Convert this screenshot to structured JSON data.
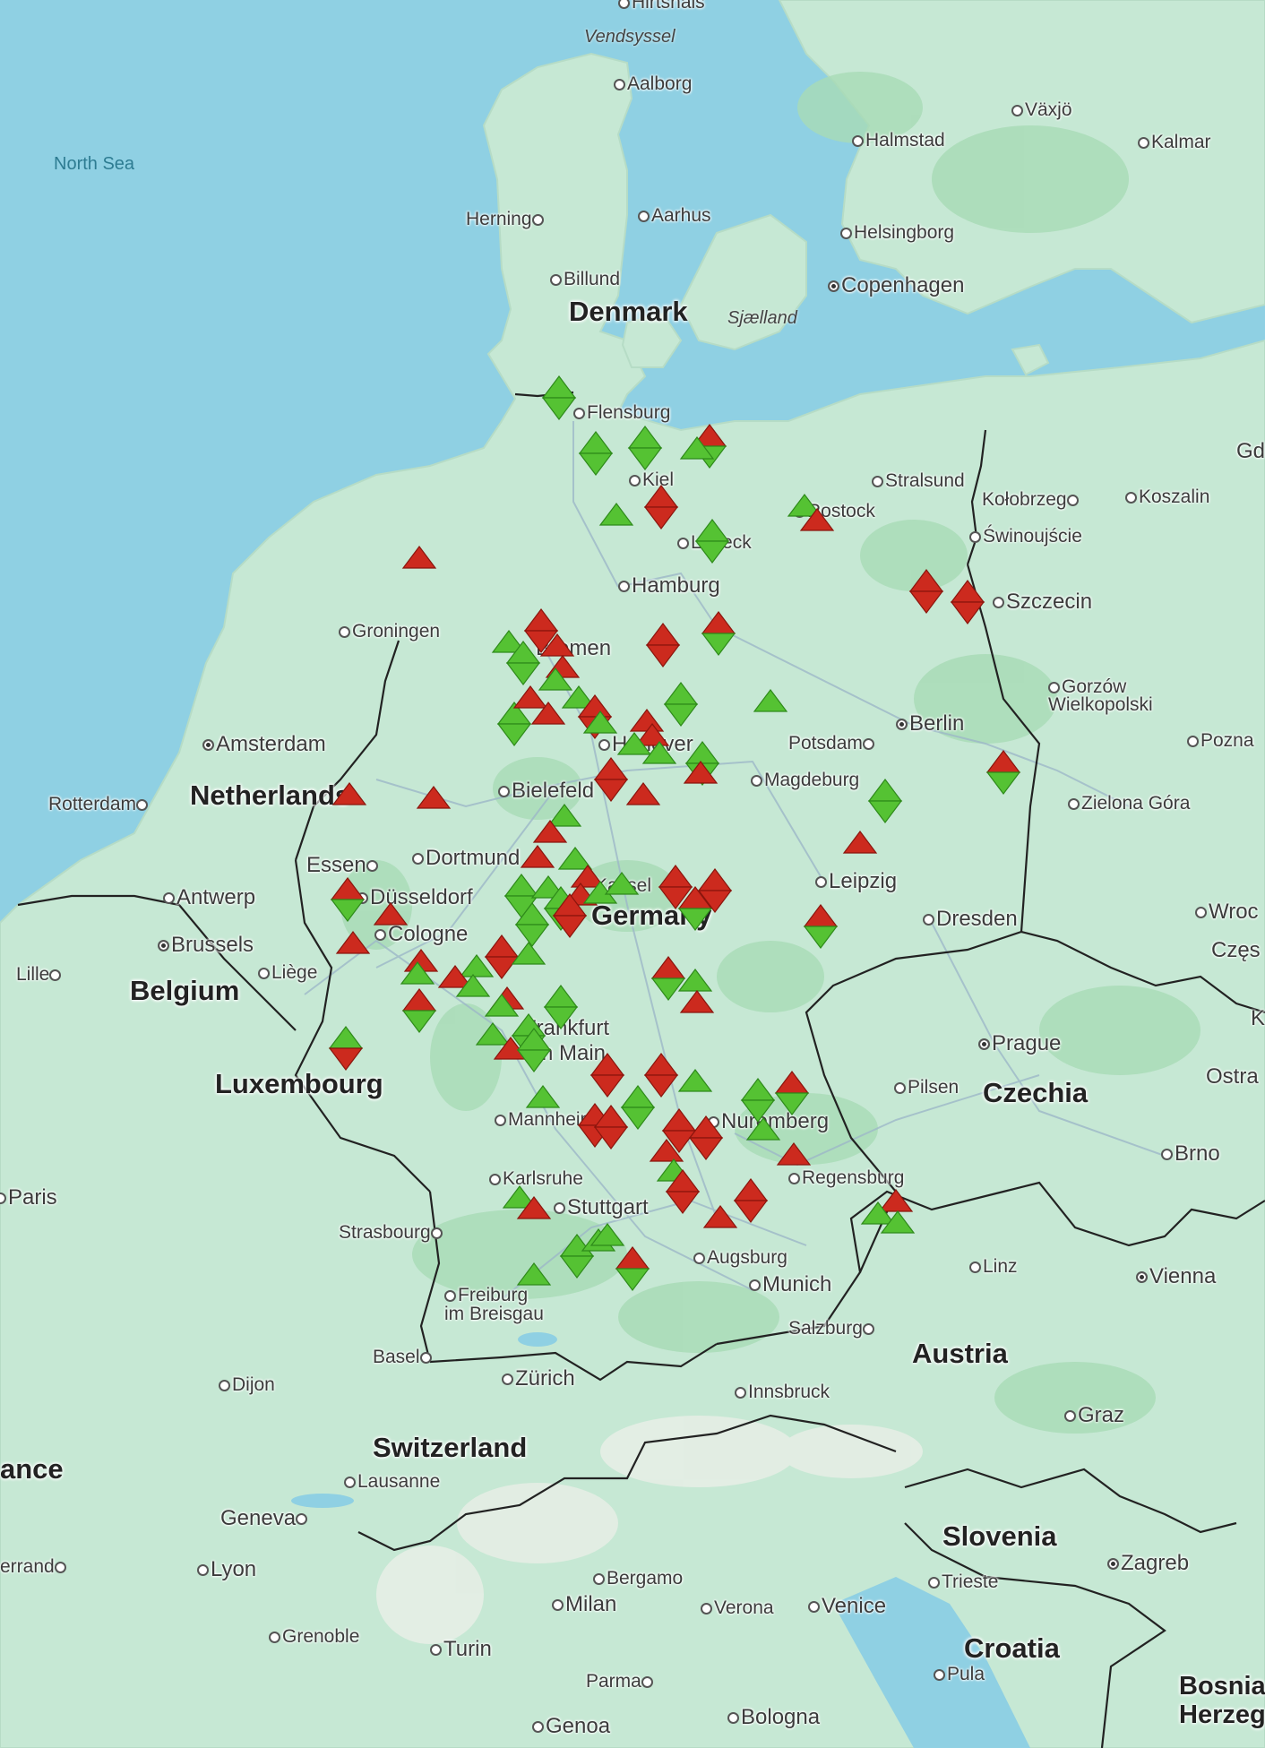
{
  "colors": {
    "water": "#8fd0e3",
    "land": "#c6e8d4",
    "forest": "#9fd6ad",
    "border": "#222222",
    "marker_green": "#55c233",
    "marker_red": "#cc2a1e"
  },
  "map": {
    "seas": [
      {
        "id": "north-sea",
        "text": "North Sea"
      }
    ],
    "regions": [
      {
        "id": "vendsyssel",
        "text": "Vendsyssel"
      },
      {
        "id": "sjaelland",
        "text": "Sjælland"
      }
    ],
    "countries": [
      {
        "id": "denmark",
        "text": "Denmark"
      },
      {
        "id": "netherlands",
        "text": "Netherlands"
      },
      {
        "id": "belgium",
        "text": "Belgium"
      },
      {
        "id": "luxembourg",
        "text": "Luxembourg"
      },
      {
        "id": "germany",
        "text": "Germany"
      },
      {
        "id": "czechia",
        "text": "Czechia"
      },
      {
        "id": "austria",
        "text": "Austria"
      },
      {
        "id": "switzerland",
        "text": "Switzerland"
      },
      {
        "id": "slovenia",
        "text": "Slovenia"
      },
      {
        "id": "croatia",
        "text": "Croatia"
      },
      {
        "id": "france",
        "text": "ance"
      },
      {
        "id": "bosnia",
        "text": "Bosnia Herzeg"
      }
    ],
    "cities": [
      {
        "id": "hirtshals",
        "text": "Hirtshals"
      },
      {
        "id": "aalborg",
        "text": "Aalborg"
      },
      {
        "id": "vaxjo",
        "text": "Växjö"
      },
      {
        "id": "halmstad",
        "text": "Halmstad"
      },
      {
        "id": "kalmar",
        "text": "Kalmar"
      },
      {
        "id": "herning",
        "text": "Herning"
      },
      {
        "id": "aarhus",
        "text": "Aarhus"
      },
      {
        "id": "helsingborg",
        "text": "Helsingborg"
      },
      {
        "id": "billund",
        "text": "Billund"
      },
      {
        "id": "copenhagen",
        "text": "Copenhagen"
      },
      {
        "id": "flensburg",
        "text": "Flensburg"
      },
      {
        "id": "gdansk",
        "text": "Gd"
      },
      {
        "id": "kiel",
        "text": "Kiel"
      },
      {
        "id": "stralsund",
        "text": "Stralsund"
      },
      {
        "id": "kolobrzeg",
        "text": "Kołobrzeg"
      },
      {
        "id": "koszalin",
        "text": "Koszalin"
      },
      {
        "id": "rostock",
        "text": "Rostock"
      },
      {
        "id": "swinoujscie",
        "text": "Świnoujście"
      },
      {
        "id": "lubeck",
        "text": "Lübeck"
      },
      {
        "id": "hamburg",
        "text": "Hamburg"
      },
      {
        "id": "szczecin",
        "text": "Szczecin"
      },
      {
        "id": "groningen",
        "text": "Groningen"
      },
      {
        "id": "bremen",
        "text": "Bremen"
      },
      {
        "id": "gorzow",
        "text": "Gorzów Wielkopolski"
      },
      {
        "id": "amsterdam",
        "text": "Amsterdam"
      },
      {
        "id": "berlin",
        "text": "Berlin"
      },
      {
        "id": "hanover",
        "text": "Hanover"
      },
      {
        "id": "potsdam",
        "text": "Potsdam"
      },
      {
        "id": "poznan",
        "text": "Pozna"
      },
      {
        "id": "rotterdam",
        "text": "Rotterdam"
      },
      {
        "id": "bielefeld",
        "text": "Bielefeld"
      },
      {
        "id": "magdeburg",
        "text": "Magdeburg"
      },
      {
        "id": "zielona-gora",
        "text": "Zielona Góra"
      },
      {
        "id": "essen",
        "text": "Essen"
      },
      {
        "id": "dortmund",
        "text": "Dortmund"
      },
      {
        "id": "leipzig",
        "text": "Leipzig"
      },
      {
        "id": "kassel",
        "text": "Kassel"
      },
      {
        "id": "antwerp",
        "text": "Antwerp"
      },
      {
        "id": "dusseldorf",
        "text": "Düsseldorf"
      },
      {
        "id": "wroclaw",
        "text": "Wroc"
      },
      {
        "id": "cologne",
        "text": "Cologne"
      },
      {
        "id": "dresden",
        "text": "Dresden"
      },
      {
        "id": "brussels",
        "text": "Brussels"
      },
      {
        "id": "czestochowa",
        "text": "Częs"
      },
      {
        "id": "lille",
        "text": "Lille"
      },
      {
        "id": "liege",
        "text": "Liège"
      },
      {
        "id": "k-partial",
        "text": "K"
      },
      {
        "id": "frankfurt",
        "text": "Frankfurt am Main"
      },
      {
        "id": "prague",
        "text": "Prague"
      },
      {
        "id": "pilsen",
        "text": "Pilsen"
      },
      {
        "id": "ostrava",
        "text": "Ostra"
      },
      {
        "id": "mannheim",
        "text": "Mannheim"
      },
      {
        "id": "nuremberg",
        "text": "Nuremberg"
      },
      {
        "id": "brno",
        "text": "Brno"
      },
      {
        "id": "karlsruhe",
        "text": "Karlsruhe"
      },
      {
        "id": "regensburg",
        "text": "Regensburg"
      },
      {
        "id": "paris",
        "text": "Paris"
      },
      {
        "id": "stuttgart",
        "text": "Stuttgart"
      },
      {
        "id": "strasbourg",
        "text": "Strasbourg"
      },
      {
        "id": "augsburg",
        "text": "Augsburg"
      },
      {
        "id": "linz",
        "text": "Linz"
      },
      {
        "id": "vienna",
        "text": "Vienna"
      },
      {
        "id": "munich",
        "text": "Munich"
      },
      {
        "id": "freiburg",
        "text": "Freiburg im Breisgau"
      },
      {
        "id": "salzburg",
        "text": "Salzburg"
      },
      {
        "id": "basel",
        "text": "Basel"
      },
      {
        "id": "zurich",
        "text": "Zürich"
      },
      {
        "id": "dijon",
        "text": "Dijon"
      },
      {
        "id": "innsbruck",
        "text": "Innsbruck"
      },
      {
        "id": "graz",
        "text": "Graz"
      },
      {
        "id": "lausanne",
        "text": "Lausanne"
      },
      {
        "id": "geneva",
        "text": "Geneva"
      },
      {
        "id": "zagreb",
        "text": "Zagreb"
      },
      {
        "id": "ferrand",
        "text": "errand"
      },
      {
        "id": "lyon",
        "text": "Lyon"
      },
      {
        "id": "bergamo",
        "text": "Bergamo"
      },
      {
        "id": "trieste",
        "text": "Trieste"
      },
      {
        "id": "milan",
        "text": "Milan"
      },
      {
        "id": "verona",
        "text": "Verona"
      },
      {
        "id": "venice",
        "text": "Venice"
      },
      {
        "id": "grenoble",
        "text": "Grenoble"
      },
      {
        "id": "turin",
        "text": "Turin"
      },
      {
        "id": "parma",
        "text": "Parma"
      },
      {
        "id": "pula",
        "text": "Pula"
      },
      {
        "id": "bologna",
        "text": "Bologna"
      },
      {
        "id": "genoa",
        "text": "Genoa"
      }
    ]
  }
}
